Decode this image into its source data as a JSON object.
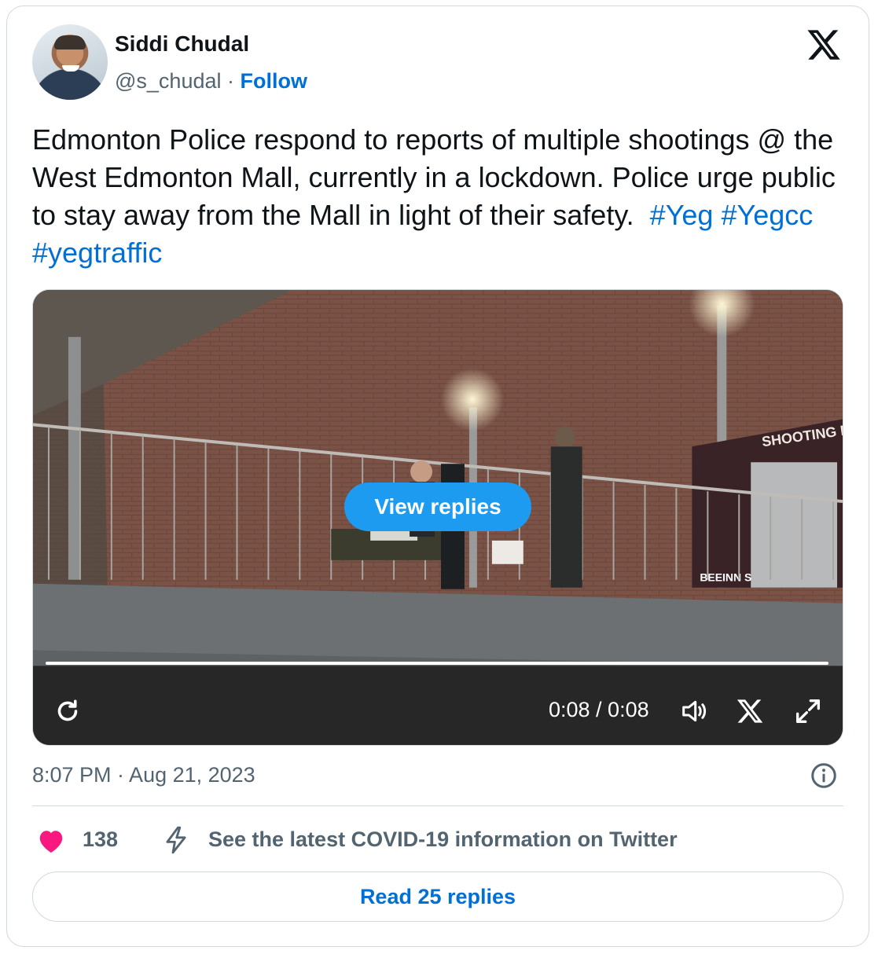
{
  "author": {
    "name": "Siddi Chudal",
    "handle": "@s_chudal",
    "separator": "·",
    "follow_label": "Follow"
  },
  "tweet": {
    "text": "Edmonton Police respond to reports of multiple shootings @ the West Edmonton Mall, currently in a lockdown. Police urge public to stay away from the Mall in light of their safety.",
    "hashtags": [
      "#Yeg",
      "#Yegcc",
      "#yegtraffic"
    ]
  },
  "video": {
    "view_replies_label": "View replies",
    "time_display": "0:08 / 0:08",
    "progress": 1.0,
    "sign_text": "SHOOTING RA",
    "poster_text": "BEEINN S"
  },
  "meta": {
    "timestamp": "8:07 PM · Aug 21, 2023",
    "likes": "138",
    "covid_link": "See the latest COVID-19 information on Twitter",
    "read_replies_label": "Read 25 replies"
  },
  "colors": {
    "link": "#006fd6",
    "heart": "#f91880",
    "button": "#1d9bf0",
    "secondary_text": "#536471"
  },
  "icons": [
    "avatar",
    "x-logo-icon",
    "replay-icon",
    "volume-icon",
    "x-icon",
    "fullscreen-icon",
    "info-icon",
    "heart-icon",
    "bolt-icon"
  ]
}
